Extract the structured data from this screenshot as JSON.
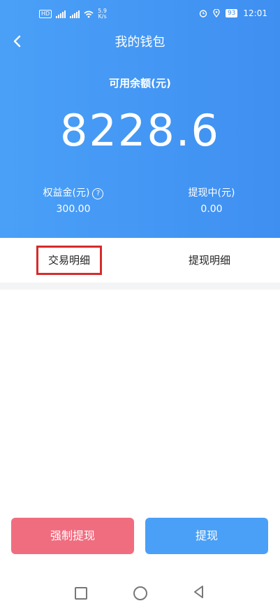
{
  "status_bar": {
    "hd_badge": "HD",
    "net_speed_value": "5.9",
    "net_speed_unit": "K/s",
    "battery": "93",
    "time": "12:01"
  },
  "header": {
    "title": "我的钱包",
    "balance_label": "可用余额(元)",
    "balance_value": "8228.6",
    "equity_label": "权益金(元)",
    "equity_value": "300.00",
    "withdrawing_label": "提现中(元)",
    "withdrawing_value": "0.00"
  },
  "tabs": [
    {
      "label": "交易明细"
    },
    {
      "label": "提现明细"
    }
  ],
  "buttons": {
    "force_withdraw": "强制提现",
    "withdraw": "提现"
  },
  "icons": {
    "back": "chevron-left-icon",
    "help": "question-circle-icon",
    "nav_recent": "square-icon",
    "nav_home": "circle-icon",
    "nav_back": "triangle-left-icon"
  },
  "colors": {
    "header_blue": "#4aa0f7",
    "force_button": "#f06d80",
    "withdraw_button": "#4aa0f7",
    "highlight_box": "#d62b2b"
  }
}
